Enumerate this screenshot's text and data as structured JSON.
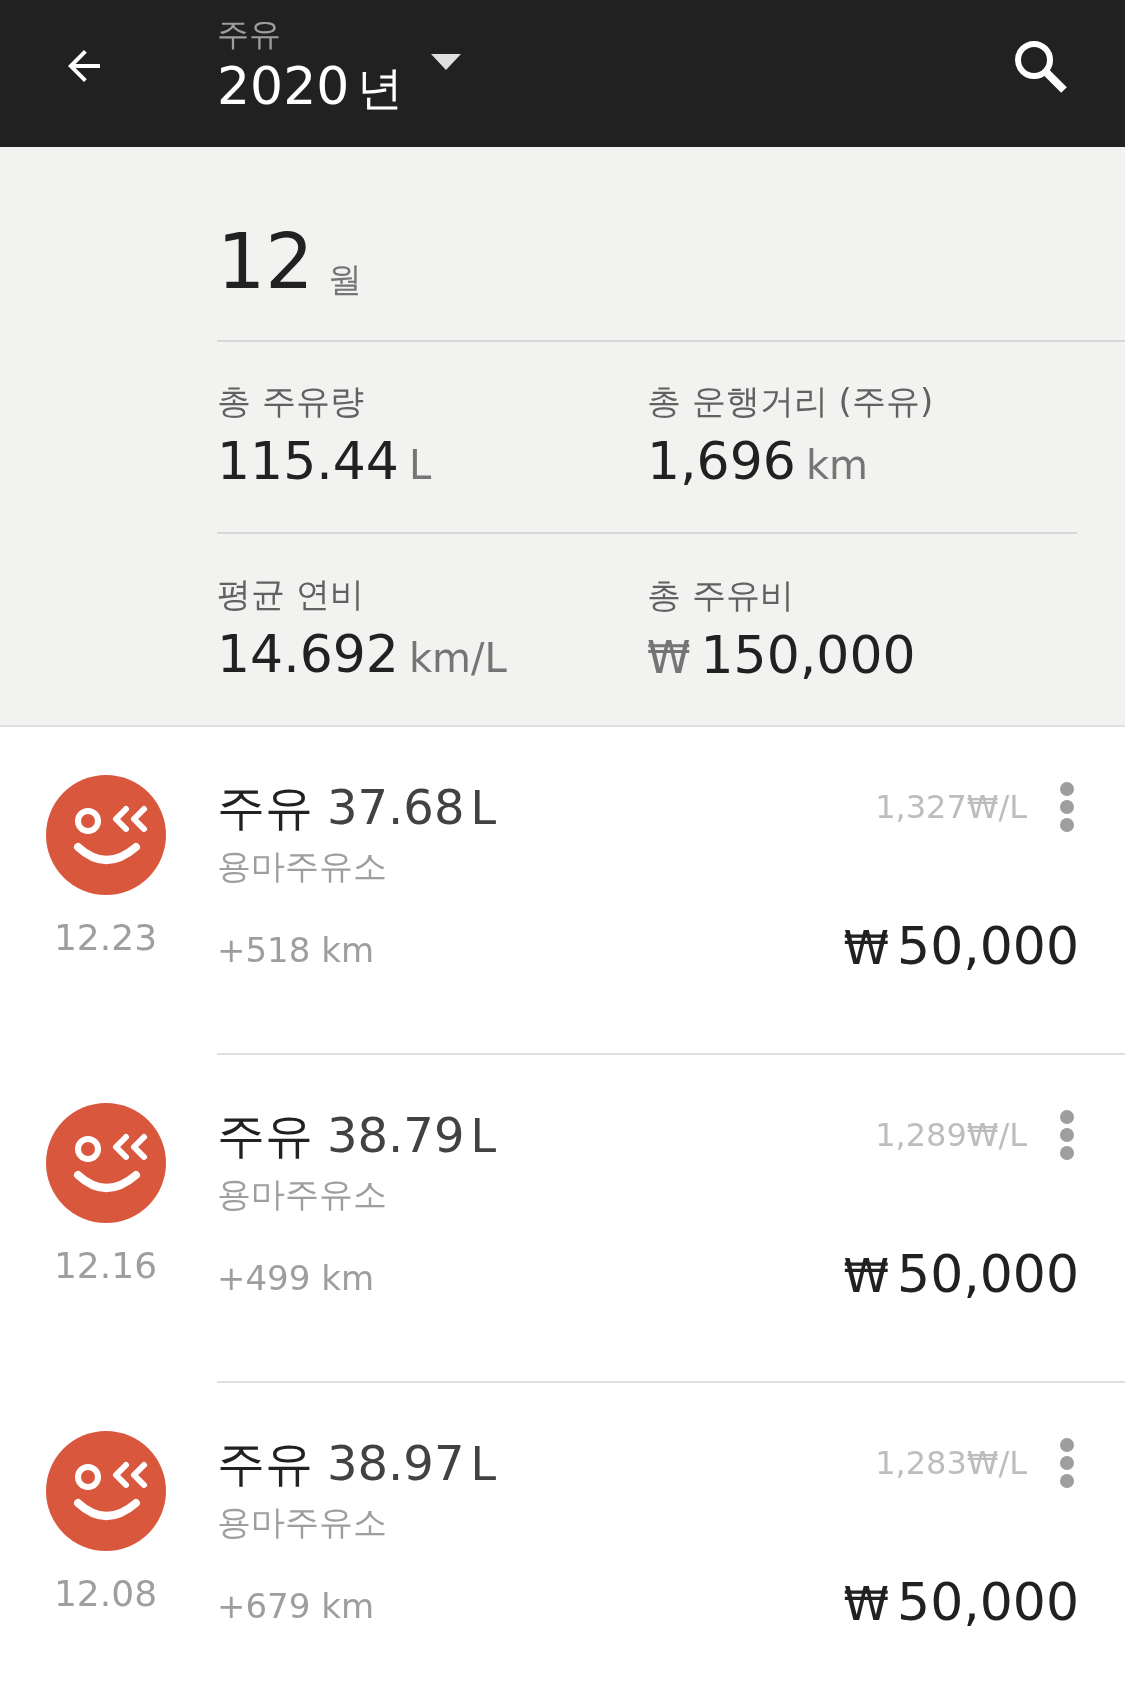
{
  "header": {
    "subtitle": "주유",
    "title_number": "2020",
    "title_unit": "년"
  },
  "month": {
    "number": "12",
    "unit": "월"
  },
  "stats": [
    {
      "kind": "suffix",
      "label": "총 주유량",
      "value": "115.44",
      "unit": "L"
    },
    {
      "kind": "suffix",
      "label": "총 운행거리 (주유)",
      "value": "1,696",
      "unit": "km"
    },
    {
      "kind": "suffix",
      "label": "평균 연비",
      "value": "14.692",
      "unit": "km/L"
    },
    {
      "kind": "prefix",
      "label": "총 주유비",
      "value": "150,000",
      "unit": "₩"
    }
  ],
  "entries": [
    {
      "date": "12.23",
      "label": "주유",
      "volume": "37.68",
      "volume_unit": "L",
      "station": "용마주유소",
      "distance": "+518 km",
      "unit_price": "1,327₩/L",
      "currency": "₩",
      "amount": "50,000"
    },
    {
      "date": "12.16",
      "label": "주유",
      "volume": "38.79",
      "volume_unit": "L",
      "station": "용마주유소",
      "distance": "+499 km",
      "unit_price": "1,289₩/L",
      "currency": "₩",
      "amount": "50,000"
    },
    {
      "date": "12.08",
      "label": "주유",
      "volume": "38.97",
      "volume_unit": "L",
      "station": "용마주유소",
      "distance": "+679 km",
      "unit_price": "1,283₩/L",
      "currency": "₩",
      "amount": "50,000"
    }
  ]
}
